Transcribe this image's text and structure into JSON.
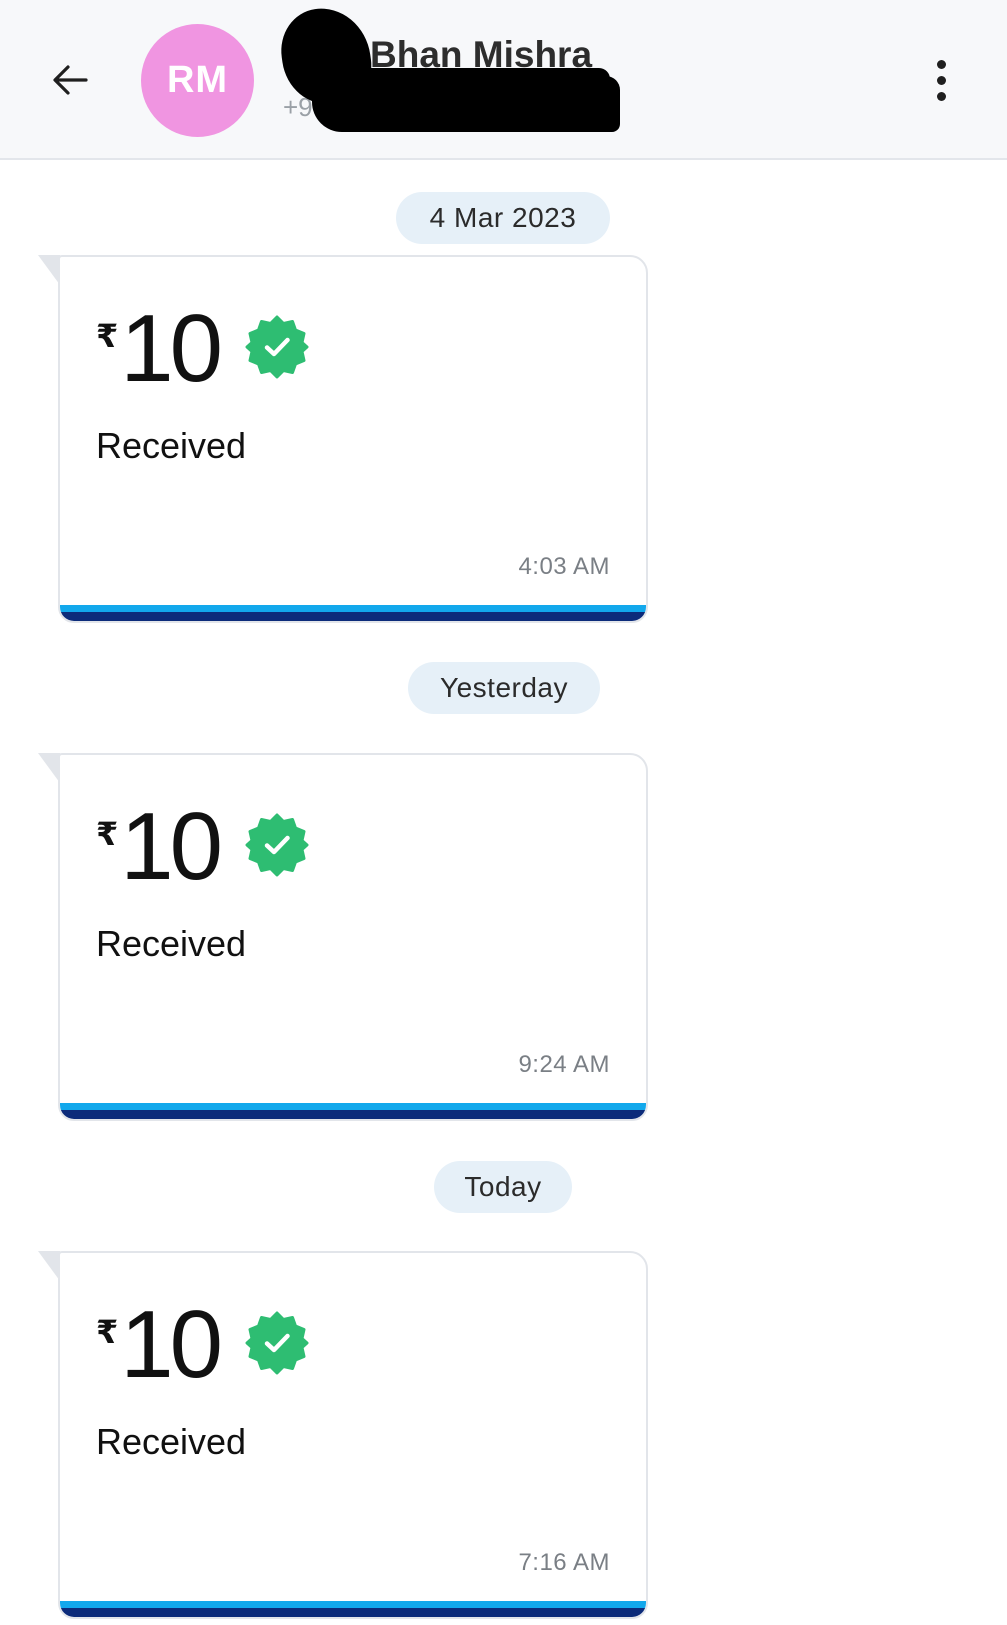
{
  "header": {
    "avatar_initials": "RM",
    "contact_name": "Bhan Mishra",
    "contact_phone": "+9",
    "back_icon": "arrow-left-icon",
    "more_icon": "more-vertical-icon"
  },
  "colors": {
    "avatar_bg": "#f095e1",
    "chip_bg": "#e6f0f8",
    "verified_green": "#2ebd72",
    "bar_light": "#12a8ec",
    "bar_dark": "#0c2b7a"
  },
  "timeline": [
    {
      "date_label": "4 Mar 2023",
      "payment": {
        "currency": "₹",
        "amount": "10",
        "status": "Received",
        "time": "4:03 AM",
        "icon": "verified-check-icon"
      }
    },
    {
      "date_label": "Yesterday",
      "payment": {
        "currency": "₹",
        "amount": "10",
        "status": "Received",
        "time": "9:24 AM",
        "icon": "verified-check-icon"
      }
    },
    {
      "date_label": "Today",
      "payment": {
        "currency": "₹",
        "amount": "10",
        "status": "Received",
        "time": "7:16 AM",
        "icon": "verified-check-icon"
      }
    }
  ]
}
